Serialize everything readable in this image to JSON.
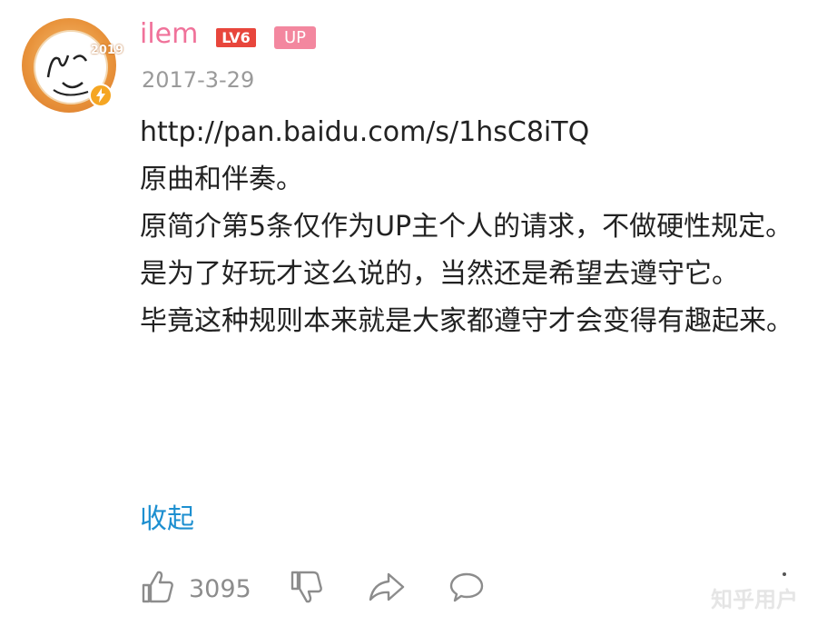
{
  "comment": {
    "username": "ilem",
    "level_badge": "LV6",
    "role_badge": "UP",
    "avatar_year": "2019",
    "date": "2017-3-29",
    "lines": [
      "http://pan.baidu.com/s/1hsC8iTQ",
      "原曲和伴奏。",
      "原简介第5条仅作为UP主个人的请求，不做硬性规定。",
      "是为了好玩才这么说的，当然还是希望去遵守它。",
      "毕竟这种规则本来就是大家都遵守才会变得有趣起来。"
    ],
    "collapse_label": "收起"
  },
  "actions": {
    "like_count": "3095"
  },
  "watermark": "知乎用户",
  "colors": {
    "username": "#f0729a",
    "level_badge": "#e8463c",
    "up_badge": "#f3879f",
    "link_blue": "#1d8fd0",
    "icon_gray": "#8c8c8c"
  },
  "icons": [
    "thumbs-up-icon",
    "thumbs-down-icon",
    "share-icon",
    "comment-icon"
  ]
}
